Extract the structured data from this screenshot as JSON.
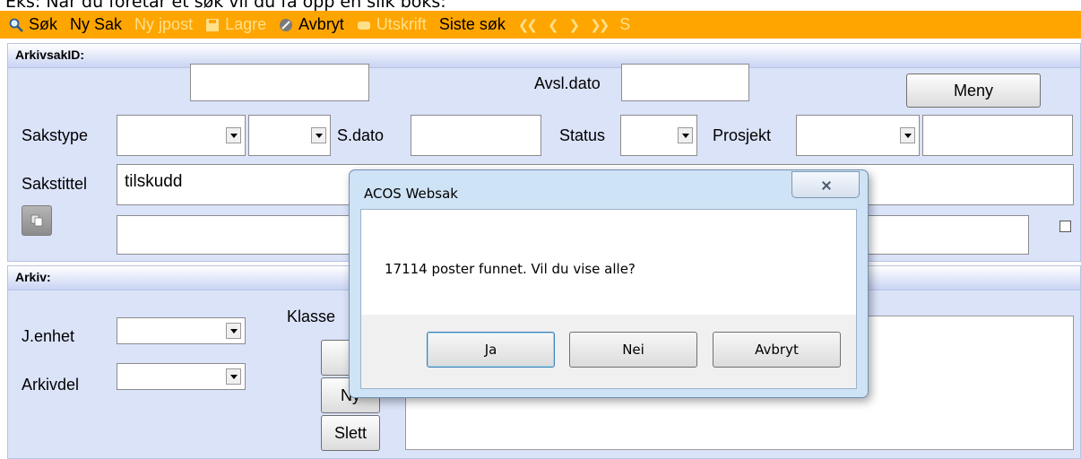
{
  "caption": "Eks: Når du foretar et søk vil du få opp en slik boks:",
  "toolbar": {
    "sok": "Søk",
    "ny_sak": "Ny Sak",
    "ny_jpost": "Ny jpost",
    "lagre": "Lagre",
    "avbryt": "Avbryt",
    "utskrift": "Utskrift",
    "siste_sok": "Siste søk",
    "last_letter": "S"
  },
  "arkivsak": {
    "header": "ArkivsakID:",
    "arkivsakid_value": "",
    "avsl_dato_label": "Avsl.dato",
    "avsl_dato_value": "",
    "meny_label": "Meny",
    "sakstype_label": "Sakstype",
    "s_dato_label": "S.dato",
    "s_dato_value": "",
    "status_label": "Status",
    "prosjekt_label": "Prosjekt",
    "sakstittel_label": "Sakstittel",
    "sakstittel_value": "tilskudd"
  },
  "arkiv": {
    "header": "Arkiv:",
    "jenhet_label": "J.enhet",
    "arkivdel_label": "Arkivdel",
    "klasse_label": "Klasse",
    "ny_label": "Ny",
    "slett_label": "Slett"
  },
  "dialog": {
    "title": "ACOS Websak",
    "message": "17114 poster funnet. Vil du vise alle?",
    "ja": "Ja",
    "nei": "Nei",
    "avbryt": "Avbryt"
  },
  "colors": {
    "toolbar": "#ffa500",
    "panel": "#dbe3f9",
    "dialog_frame": "#cfe3f6"
  }
}
